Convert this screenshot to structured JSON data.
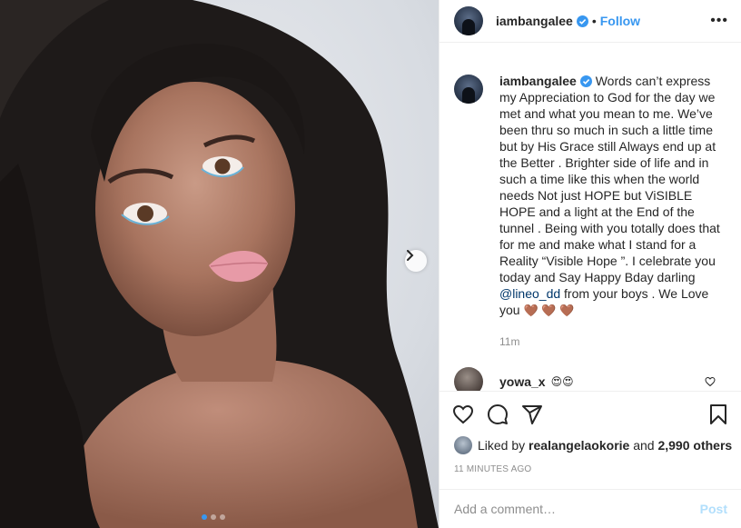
{
  "post": {
    "author": "iambangalee",
    "separator": "•",
    "follow_label": "Follow",
    "more_label": "•••",
    "photo_alt": "Portrait photo",
    "carousel_count": 3,
    "carousel_active_index": 0
  },
  "caption": {
    "username": "iambangalee",
    "text_before_mention": "Words can’t express my Appreciation to God for the day we met and what you mean to me. We’ve been thru so much in such a little time but by His Grace still Always end up at the Better . Brighter side of life and in such a time like this when the world needs Not just HOPE but ViSIBLE HOPE and a light at the End of the tunnel . Being with you totally does that for me and make what I stand for a Reality “Visible Hope ”. I celebrate you today and Say Happy Bday darling ",
    "mention": "@lineo_dd",
    "text_after_mention": " from your boys . We Love you ",
    "hearts": "🤎 🤎 🤎",
    "time": "11m"
  },
  "comment": {
    "username": "yowa_x",
    "text": "😍😍"
  },
  "likes": {
    "prefix": "Liked by ",
    "user": "realangelaokorie",
    "middle": " and ",
    "others": "2,990 others"
  },
  "timestamp": "11 MINUTES AGO",
  "add_comment": {
    "placeholder": "Add a comment…",
    "post_label": "Post"
  },
  "icons": {
    "verified": "verified-badge-icon",
    "heart": "heart-icon",
    "comment": "comment-icon",
    "share": "share-icon",
    "bookmark": "bookmark-icon",
    "next": "chevron-right-icon"
  },
  "colors": {
    "accent": "#3897f0",
    "text": "#262626",
    "muted": "#8e8e8e",
    "post_disabled": "#b2dffc",
    "mention": "#00376b"
  }
}
